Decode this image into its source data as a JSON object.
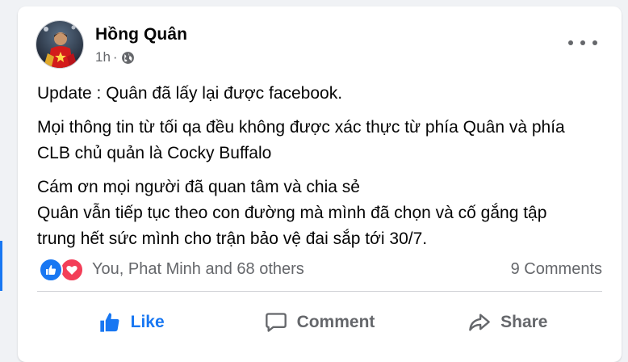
{
  "post": {
    "author": "Hồng Quân",
    "time": "1h",
    "separator": "·",
    "audience_icon": "globe-icon",
    "paragraphs": [
      [
        "Update : Quân đã lấy lại được facebook."
      ],
      [
        "Mọi thông tin từ tối qa đều không được xác thực từ phía Quân và phía",
        "CLB chủ quản là Cocky Buffalo"
      ],
      [
        "Cám ơn mọi người đã quan tâm và chia sẻ",
        "Quân vẫn tiếp tục theo con đường mà mình đã chọn và cố gắng tập",
        "trung hết sức mình cho trận bảo vệ đai sắp tới 30/7."
      ]
    ]
  },
  "reactions": {
    "icons": [
      "like-reaction-icon",
      "love-reaction-icon"
    ],
    "summary": "You, Phat Minh and 68 others",
    "comments": "9 Comments"
  },
  "actions": {
    "like": "Like",
    "comment": "Comment",
    "share": "Share"
  },
  "colors": {
    "accent": "#1877f2",
    "love": "#f33e58",
    "secondary_text": "#65676b"
  }
}
